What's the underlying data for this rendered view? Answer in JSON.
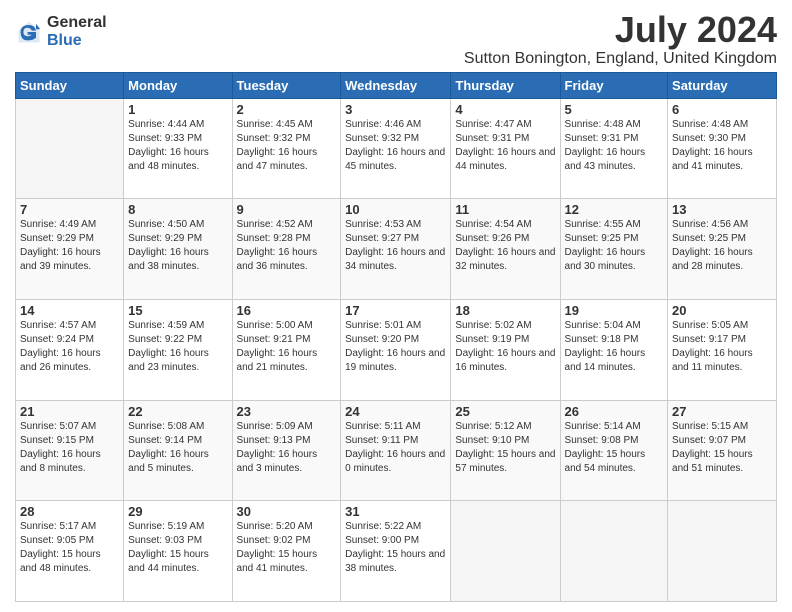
{
  "logo": {
    "general": "General",
    "blue": "Blue"
  },
  "title": "July 2024",
  "location": "Sutton Bonington, England, United Kingdom",
  "headers": [
    "Sunday",
    "Monday",
    "Tuesday",
    "Wednesday",
    "Thursday",
    "Friday",
    "Saturday"
  ],
  "weeks": [
    [
      {
        "day": "",
        "sunrise": "",
        "sunset": "",
        "daylight": ""
      },
      {
        "day": "1",
        "sunrise": "Sunrise: 4:44 AM",
        "sunset": "Sunset: 9:33 PM",
        "daylight": "Daylight: 16 hours and 48 minutes."
      },
      {
        "day": "2",
        "sunrise": "Sunrise: 4:45 AM",
        "sunset": "Sunset: 9:32 PM",
        "daylight": "Daylight: 16 hours and 47 minutes."
      },
      {
        "day": "3",
        "sunrise": "Sunrise: 4:46 AM",
        "sunset": "Sunset: 9:32 PM",
        "daylight": "Daylight: 16 hours and 45 minutes."
      },
      {
        "day": "4",
        "sunrise": "Sunrise: 4:47 AM",
        "sunset": "Sunset: 9:31 PM",
        "daylight": "Daylight: 16 hours and 44 minutes."
      },
      {
        "day": "5",
        "sunrise": "Sunrise: 4:48 AM",
        "sunset": "Sunset: 9:31 PM",
        "daylight": "Daylight: 16 hours and 43 minutes."
      },
      {
        "day": "6",
        "sunrise": "Sunrise: 4:48 AM",
        "sunset": "Sunset: 9:30 PM",
        "daylight": "Daylight: 16 hours and 41 minutes."
      }
    ],
    [
      {
        "day": "7",
        "sunrise": "Sunrise: 4:49 AM",
        "sunset": "Sunset: 9:29 PM",
        "daylight": "Daylight: 16 hours and 39 minutes."
      },
      {
        "day": "8",
        "sunrise": "Sunrise: 4:50 AM",
        "sunset": "Sunset: 9:29 PM",
        "daylight": "Daylight: 16 hours and 38 minutes."
      },
      {
        "day": "9",
        "sunrise": "Sunrise: 4:52 AM",
        "sunset": "Sunset: 9:28 PM",
        "daylight": "Daylight: 16 hours and 36 minutes."
      },
      {
        "day": "10",
        "sunrise": "Sunrise: 4:53 AM",
        "sunset": "Sunset: 9:27 PM",
        "daylight": "Daylight: 16 hours and 34 minutes."
      },
      {
        "day": "11",
        "sunrise": "Sunrise: 4:54 AM",
        "sunset": "Sunset: 9:26 PM",
        "daylight": "Daylight: 16 hours and 32 minutes."
      },
      {
        "day": "12",
        "sunrise": "Sunrise: 4:55 AM",
        "sunset": "Sunset: 9:25 PM",
        "daylight": "Daylight: 16 hours and 30 minutes."
      },
      {
        "day": "13",
        "sunrise": "Sunrise: 4:56 AM",
        "sunset": "Sunset: 9:25 PM",
        "daylight": "Daylight: 16 hours and 28 minutes."
      }
    ],
    [
      {
        "day": "14",
        "sunrise": "Sunrise: 4:57 AM",
        "sunset": "Sunset: 9:24 PM",
        "daylight": "Daylight: 16 hours and 26 minutes."
      },
      {
        "day": "15",
        "sunrise": "Sunrise: 4:59 AM",
        "sunset": "Sunset: 9:22 PM",
        "daylight": "Daylight: 16 hours and 23 minutes."
      },
      {
        "day": "16",
        "sunrise": "Sunrise: 5:00 AM",
        "sunset": "Sunset: 9:21 PM",
        "daylight": "Daylight: 16 hours and 21 minutes."
      },
      {
        "day": "17",
        "sunrise": "Sunrise: 5:01 AM",
        "sunset": "Sunset: 9:20 PM",
        "daylight": "Daylight: 16 hours and 19 minutes."
      },
      {
        "day": "18",
        "sunrise": "Sunrise: 5:02 AM",
        "sunset": "Sunset: 9:19 PM",
        "daylight": "Daylight: 16 hours and 16 minutes."
      },
      {
        "day": "19",
        "sunrise": "Sunrise: 5:04 AM",
        "sunset": "Sunset: 9:18 PM",
        "daylight": "Daylight: 16 hours and 14 minutes."
      },
      {
        "day": "20",
        "sunrise": "Sunrise: 5:05 AM",
        "sunset": "Sunset: 9:17 PM",
        "daylight": "Daylight: 16 hours and 11 minutes."
      }
    ],
    [
      {
        "day": "21",
        "sunrise": "Sunrise: 5:07 AM",
        "sunset": "Sunset: 9:15 PM",
        "daylight": "Daylight: 16 hours and 8 minutes."
      },
      {
        "day": "22",
        "sunrise": "Sunrise: 5:08 AM",
        "sunset": "Sunset: 9:14 PM",
        "daylight": "Daylight: 16 hours and 5 minutes."
      },
      {
        "day": "23",
        "sunrise": "Sunrise: 5:09 AM",
        "sunset": "Sunset: 9:13 PM",
        "daylight": "Daylight: 16 hours and 3 minutes."
      },
      {
        "day": "24",
        "sunrise": "Sunrise: 5:11 AM",
        "sunset": "Sunset: 9:11 PM",
        "daylight": "Daylight: 16 hours and 0 minutes."
      },
      {
        "day": "25",
        "sunrise": "Sunrise: 5:12 AM",
        "sunset": "Sunset: 9:10 PM",
        "daylight": "Daylight: 15 hours and 57 minutes."
      },
      {
        "day": "26",
        "sunrise": "Sunrise: 5:14 AM",
        "sunset": "Sunset: 9:08 PM",
        "daylight": "Daylight: 15 hours and 54 minutes."
      },
      {
        "day": "27",
        "sunrise": "Sunrise: 5:15 AM",
        "sunset": "Sunset: 9:07 PM",
        "daylight": "Daylight: 15 hours and 51 minutes."
      }
    ],
    [
      {
        "day": "28",
        "sunrise": "Sunrise: 5:17 AM",
        "sunset": "Sunset: 9:05 PM",
        "daylight": "Daylight: 15 hours and 48 minutes."
      },
      {
        "day": "29",
        "sunrise": "Sunrise: 5:19 AM",
        "sunset": "Sunset: 9:03 PM",
        "daylight": "Daylight: 15 hours and 44 minutes."
      },
      {
        "day": "30",
        "sunrise": "Sunrise: 5:20 AM",
        "sunset": "Sunset: 9:02 PM",
        "daylight": "Daylight: 15 hours and 41 minutes."
      },
      {
        "day": "31",
        "sunrise": "Sunrise: 5:22 AM",
        "sunset": "Sunset: 9:00 PM",
        "daylight": "Daylight: 15 hours and 38 minutes."
      },
      {
        "day": "",
        "sunrise": "",
        "sunset": "",
        "daylight": ""
      },
      {
        "day": "",
        "sunrise": "",
        "sunset": "",
        "daylight": ""
      },
      {
        "day": "",
        "sunrise": "",
        "sunset": "",
        "daylight": ""
      }
    ]
  ]
}
